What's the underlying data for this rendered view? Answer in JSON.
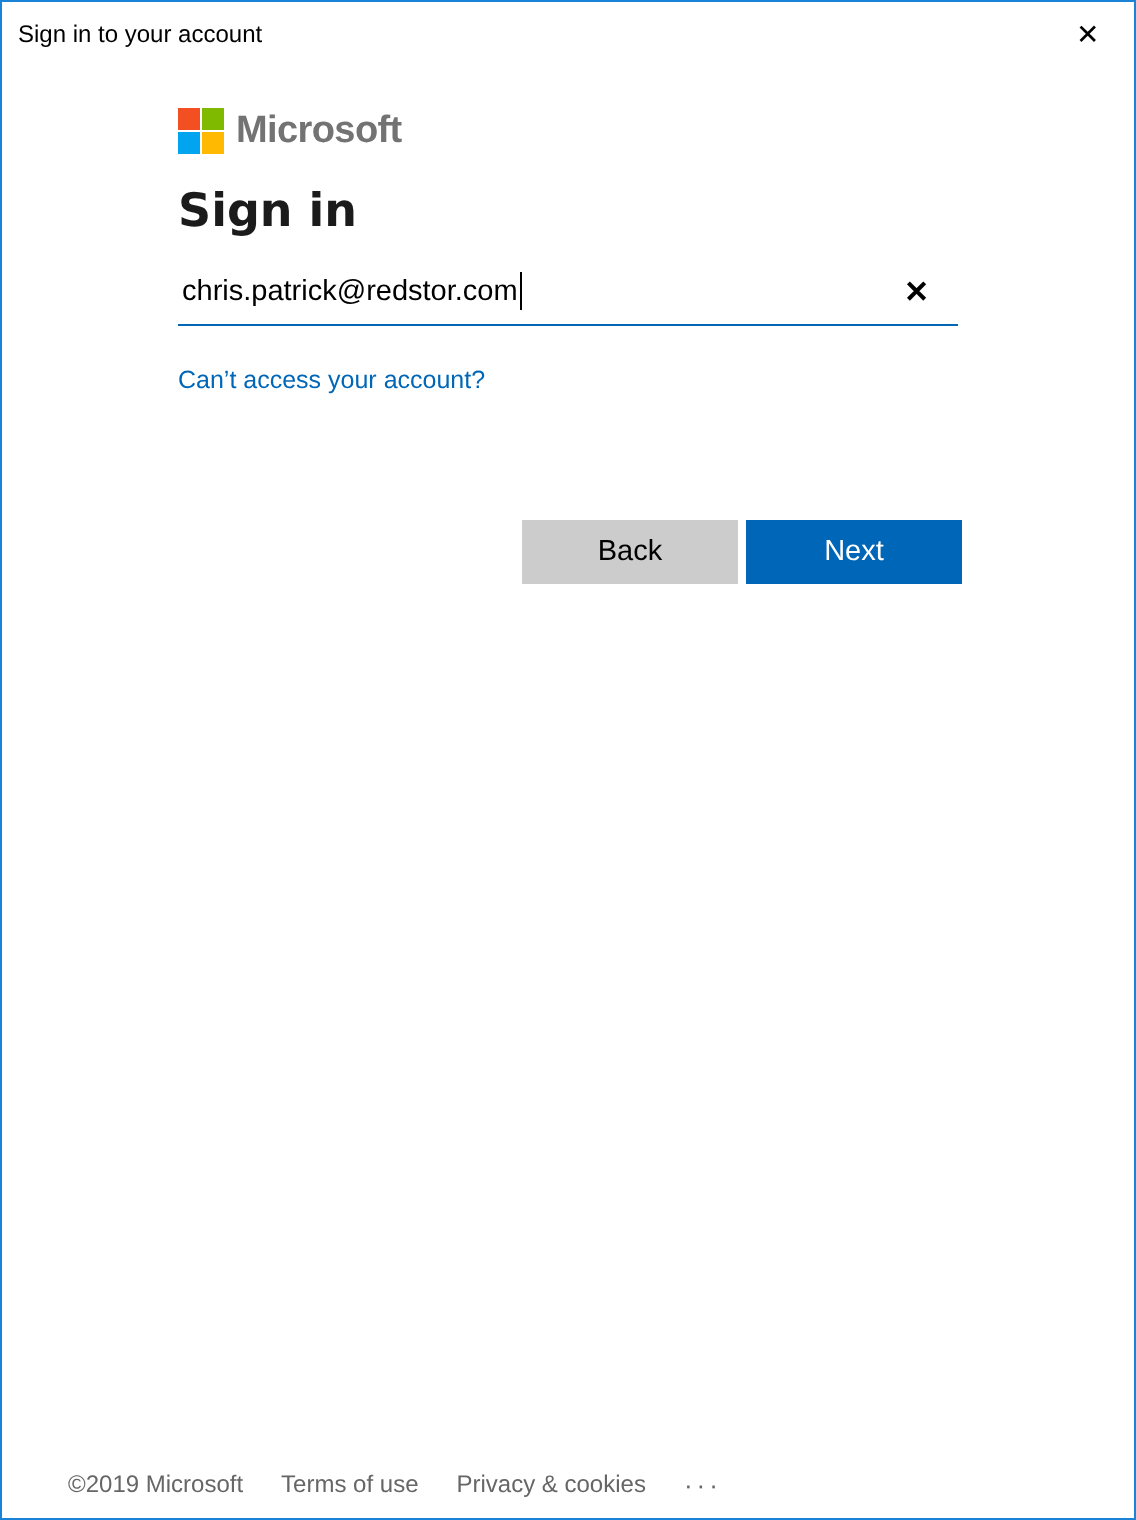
{
  "window": {
    "title": "Sign in to your account",
    "close": "✕"
  },
  "logo": {
    "text": "Microsoft"
  },
  "heading": "Sign in",
  "email_field": {
    "value": "chris.patrick@redstor.com",
    "focused": true,
    "clear": "✕"
  },
  "help_link": "Can’t access your account?",
  "buttons": [
    {
      "label": "Back",
      "kind": "secondary"
    },
    {
      "label": "Next",
      "kind": "primary"
    }
  ],
  "footer": {
    "copyright": "©2019 Microsoft",
    "links": [
      "Terms of use",
      "Privacy & cookies"
    ],
    "more": "···"
  }
}
